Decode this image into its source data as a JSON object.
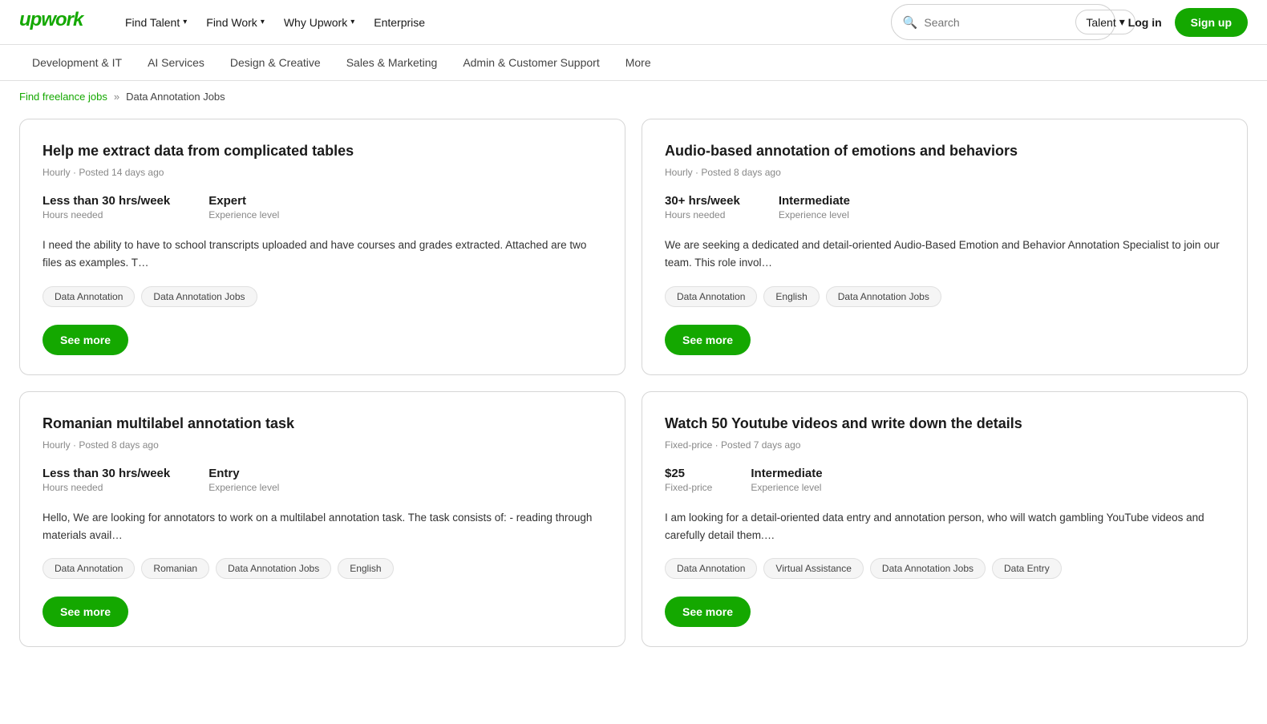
{
  "nav": {
    "logo": "upwork",
    "links": [
      {
        "label": "Find Talent",
        "hasChevron": true
      },
      {
        "label": "Find Work",
        "hasChevron": true
      },
      {
        "label": "Why Upwork",
        "hasChevron": true
      },
      {
        "label": "Enterprise",
        "hasChevron": false
      }
    ],
    "search_placeholder": "Search",
    "talent_selector": "Talent",
    "login_label": "Log in",
    "signup_label": "Sign up"
  },
  "category_nav": {
    "items": [
      "Development & IT",
      "AI Services",
      "Design & Creative",
      "Sales & Marketing",
      "Admin & Customer Support",
      "More"
    ]
  },
  "breadcrumb": {
    "parent_label": "Find freelance jobs",
    "separator": "»",
    "current": "Data Annotation Jobs"
  },
  "jobs": [
    {
      "id": "job1",
      "title": "Help me extract data from complicated tables",
      "meta": "Hourly · Posted 14 days ago",
      "stats": [
        {
          "label": "Hours needed",
          "value": "Less than 30 hrs/week"
        },
        {
          "label": "Experience level",
          "value": "Expert"
        }
      ],
      "description": "I need the ability to have to school transcripts uploaded and have courses and grades extracted. Attached are two files as examples. T…",
      "tags": [
        "Data Annotation",
        "Data Annotation Jobs"
      ],
      "see_more": "See more"
    },
    {
      "id": "job2",
      "title": "Audio-based annotation of emotions and behaviors",
      "meta": "Hourly · Posted 8 days ago",
      "stats": [
        {
          "label": "Hours needed",
          "value": "30+ hrs/week"
        },
        {
          "label": "Experience level",
          "value": "Intermediate"
        }
      ],
      "description": "We are seeking a dedicated and detail-oriented Audio-Based Emotion and Behavior Annotation Specialist to join our team. This role invol…",
      "tags": [
        "Data Annotation",
        "English",
        "Data Annotation Jobs"
      ],
      "see_more": "See more"
    },
    {
      "id": "job3",
      "title": "Romanian multilabel annotation task",
      "meta": "Hourly · Posted 8 days ago",
      "stats": [
        {
          "label": "Hours needed",
          "value": "Less than 30 hrs/week"
        },
        {
          "label": "Experience level",
          "value": "Entry"
        }
      ],
      "description": "Hello, We are looking for annotators to work on a multilabel annotation task. The task consists of: - reading through materials avail…",
      "tags": [
        "Data Annotation",
        "Romanian",
        "Data Annotation Jobs",
        "English"
      ],
      "see_more": "See more"
    },
    {
      "id": "job4",
      "title": "Watch 50 Youtube videos and write down the details",
      "meta": "Fixed-price · Posted 7 days ago",
      "stats": [
        {
          "label": "Fixed-price",
          "value": "$25"
        },
        {
          "label": "Experience level",
          "value": "Intermediate"
        }
      ],
      "description": "I am looking for a detail-oriented data entry and annotation person, who will watch gambling YouTube videos and carefully detail them.…",
      "tags": [
        "Data Annotation",
        "Virtual Assistance",
        "Data Annotation Jobs",
        "Data Entry"
      ],
      "see_more": "See more"
    }
  ]
}
